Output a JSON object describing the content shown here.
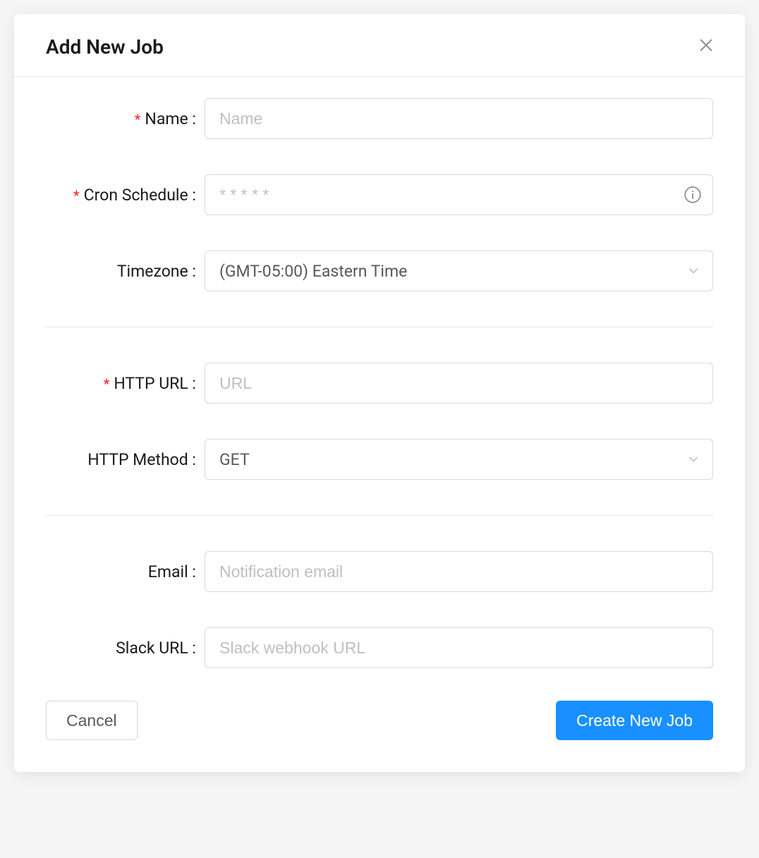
{
  "modal": {
    "title": "Add New Job"
  },
  "form": {
    "name": {
      "label": "Name",
      "placeholder": "Name",
      "required": true
    },
    "cron": {
      "label": "Cron Schedule",
      "placeholder": "* * * * *",
      "required": true
    },
    "timezone": {
      "label": "Timezone",
      "value": "(GMT-05:00) Eastern Time",
      "required": false
    },
    "http_url": {
      "label": "HTTP URL",
      "placeholder": "URL",
      "required": true
    },
    "http_method": {
      "label": "HTTP Method",
      "value": "GET",
      "required": false
    },
    "email": {
      "label": "Email",
      "placeholder": "Notification email",
      "required": false
    },
    "slack_url": {
      "label": "Slack URL",
      "placeholder": "Slack webhook URL",
      "required": false
    }
  },
  "footer": {
    "cancel_label": "Cancel",
    "submit_label": "Create New Job"
  }
}
